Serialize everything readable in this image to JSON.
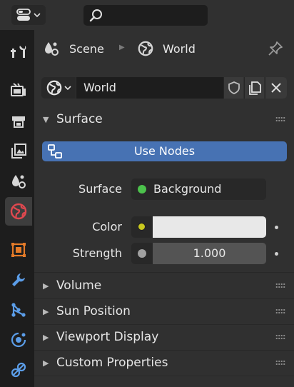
{
  "header": {
    "editor_icon": "properties-editor-icon",
    "search_icon": "search-icon"
  },
  "tabs": [
    {
      "name": "tool",
      "icon": "tool-icon"
    },
    {
      "name": "render",
      "icon": "render-icon"
    },
    {
      "name": "output",
      "icon": "output-icon"
    },
    {
      "name": "view-layer",
      "icon": "view-layer-icon"
    },
    {
      "name": "scene",
      "icon": "scene-icon"
    },
    {
      "name": "world",
      "icon": "world-icon",
      "active": true
    },
    {
      "name": "object",
      "icon": "object-icon"
    },
    {
      "name": "modifiers",
      "icon": "wrench-icon"
    },
    {
      "name": "particles",
      "icon": "particles-icon"
    },
    {
      "name": "physics",
      "icon": "physics-icon"
    },
    {
      "name": "constraints",
      "icon": "constraints-icon"
    }
  ],
  "breadcrumb": {
    "scene": "Scene",
    "world": "World"
  },
  "id_block": {
    "name": "World"
  },
  "surface_panel": {
    "title": "Surface",
    "use_nodes": "Use Nodes",
    "surface_label": "Surface",
    "surface_value": "Background",
    "color_label": "Color",
    "strength_label": "Strength",
    "strength_value": "1.000"
  },
  "collapsed_panels": {
    "volume": "Volume",
    "sun_position": "Sun Position",
    "viewport_display": "Viewport Display",
    "custom_properties": "Custom Properties"
  },
  "colors": {
    "accent": "#4772b3",
    "surface_dot": "#4cc24c",
    "color_dot": "#c8c81e",
    "strength_dot": "#a0a0a0",
    "active_tab_icon": "#e0484f",
    "object_icon": "#e57b28",
    "blue_icon": "#5b9de8"
  }
}
